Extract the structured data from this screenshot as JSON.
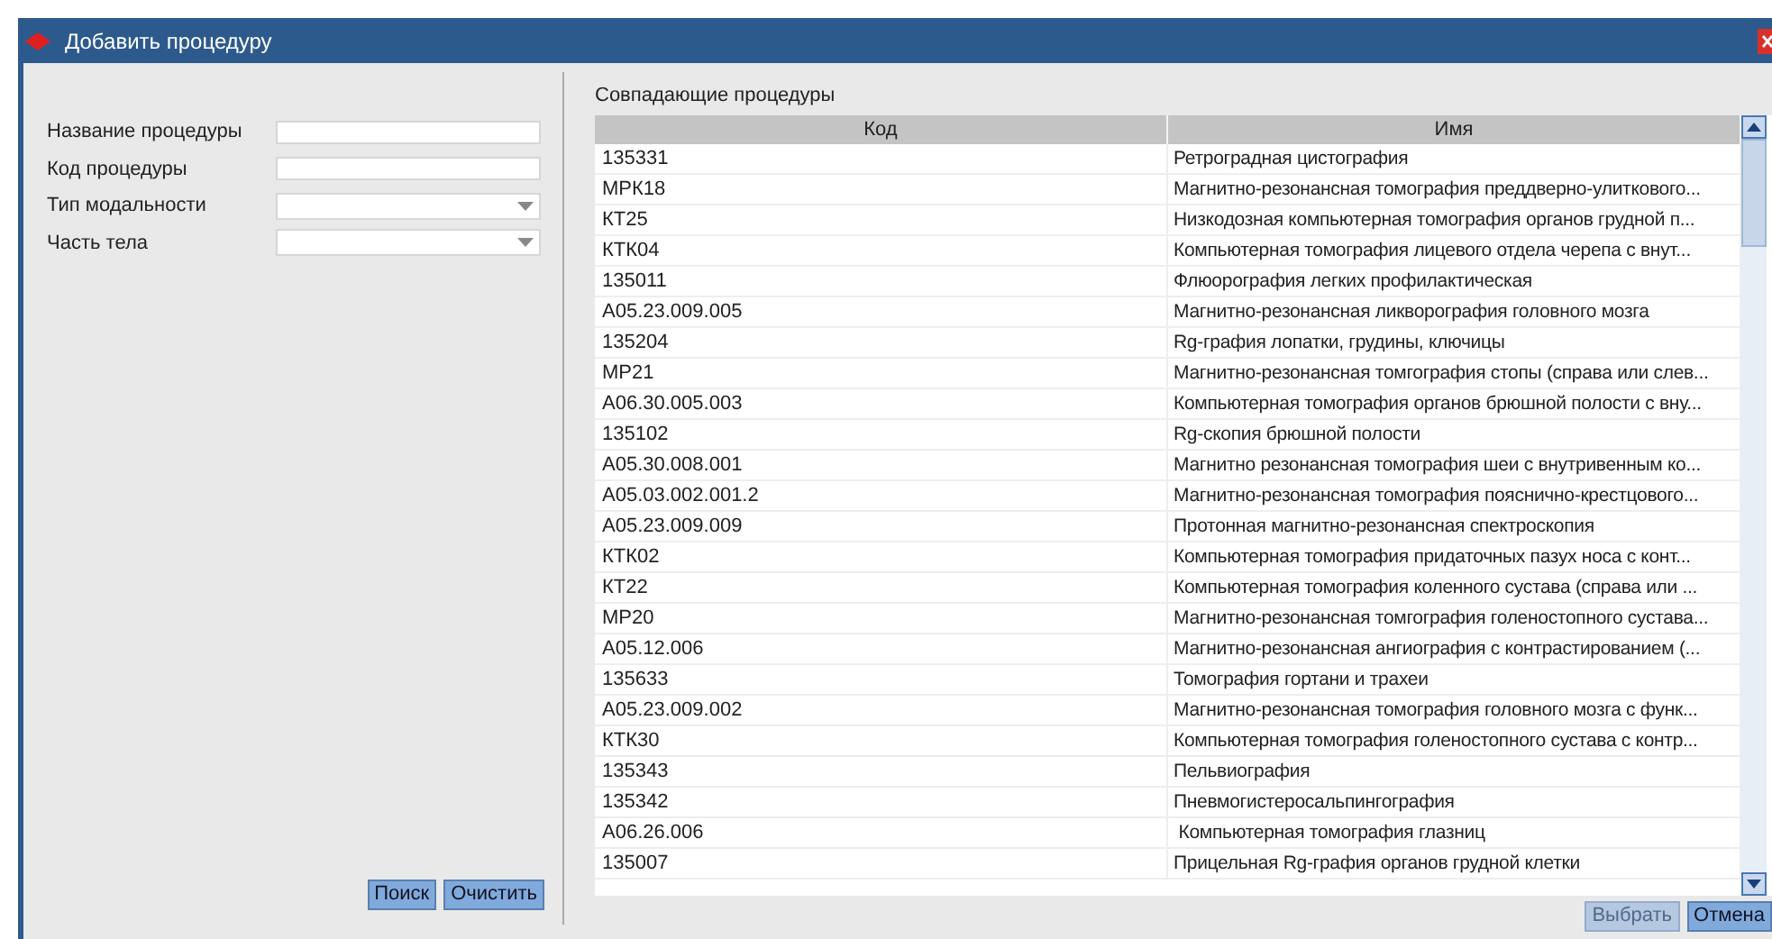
{
  "window": {
    "title": "Добавить процедуру"
  },
  "form": {
    "fields": [
      {
        "label": "Название процедуры",
        "kind": "text"
      },
      {
        "label": "Код процедуры",
        "kind": "text"
      },
      {
        "label": "Тип модальности",
        "kind": "dropdown"
      },
      {
        "label": "Часть тела",
        "kind": "dropdown"
      }
    ],
    "buttons": [
      {
        "label": "Поиск",
        "disabled": false
      },
      {
        "label": "Очистить",
        "disabled": false
      }
    ]
  },
  "results": {
    "title": "Совпадающие процедуры",
    "table": {
      "columns": [
        "Код",
        "Имя"
      ],
      "rows": [
        [
          "135331",
          "Ретроградная цистография"
        ],
        [
          "МРК18",
          "Магнитно-резонансная томография преддверно-улиткового..."
        ],
        [
          "КТ25",
          "Низкодозная компьютерная томография органов грудной п..."
        ],
        [
          "КТК04",
          "Компьютерная томография лицевого отдела черепа с внут..."
        ],
        [
          "135011",
          "Флюорография легких профилактическая"
        ],
        [
          "A05.23.009.005",
          "Магнитно-резонансная ликворография головного мозга"
        ],
        [
          "135204",
          "Rg-графия лопатки, грудины, ключицы"
        ],
        [
          "МР21",
          "Магнитно-резонансная томгография стопы (справа или слев..."
        ],
        [
          "A06.30.005.003",
          "Компьютерная томография органов брюшной полости с вну..."
        ],
        [
          "135102",
          "Rg-скопия брюшной полости"
        ],
        [
          "A05.30.008.001",
          "Магнитно резонансная томография шеи с внутривенным ко..."
        ],
        [
          "A05.03.002.001.2",
          "Магнитно-резонансная томография пояснично-крестцового..."
        ],
        [
          "A05.23.009.009",
          "Протонная магнитно-резонансная спектроскопия"
        ],
        [
          "КТК02",
          "Компьютерная томография придаточных пазух носа с конт..."
        ],
        [
          "КТ22",
          "Компьютерная томография коленного сустава (справа или ..."
        ],
        [
          "МР20",
          "Магнитно-резонансная томгография голеностопного сустава..."
        ],
        [
          "A05.12.006",
          "Магнитно-резонансная ангиография с контрастированием (..."
        ],
        [
          "135633",
          "Томография гортани и трахеи"
        ],
        [
          "A05.23.009.002",
          "Магнитно-резонансная томография головного мозга с функ..."
        ],
        [
          "КТК30",
          "Компьютерная томография голеностопного сустава с контр..."
        ],
        [
          "135343",
          "Пельвиография"
        ],
        [
          "135342",
          "Пневмогистеросальпингография"
        ],
        [
          "A06.26.006",
          " Компьютерная томография глазниц"
        ],
        [
          "135007",
          "Прицельная Rg-графия органов грудной клетки"
        ]
      ]
    }
  },
  "buttons": [
    {
      "label": "Выбрать",
      "disabled": true
    },
    {
      "label": "Отмена",
      "disabled": false
    }
  ]
}
